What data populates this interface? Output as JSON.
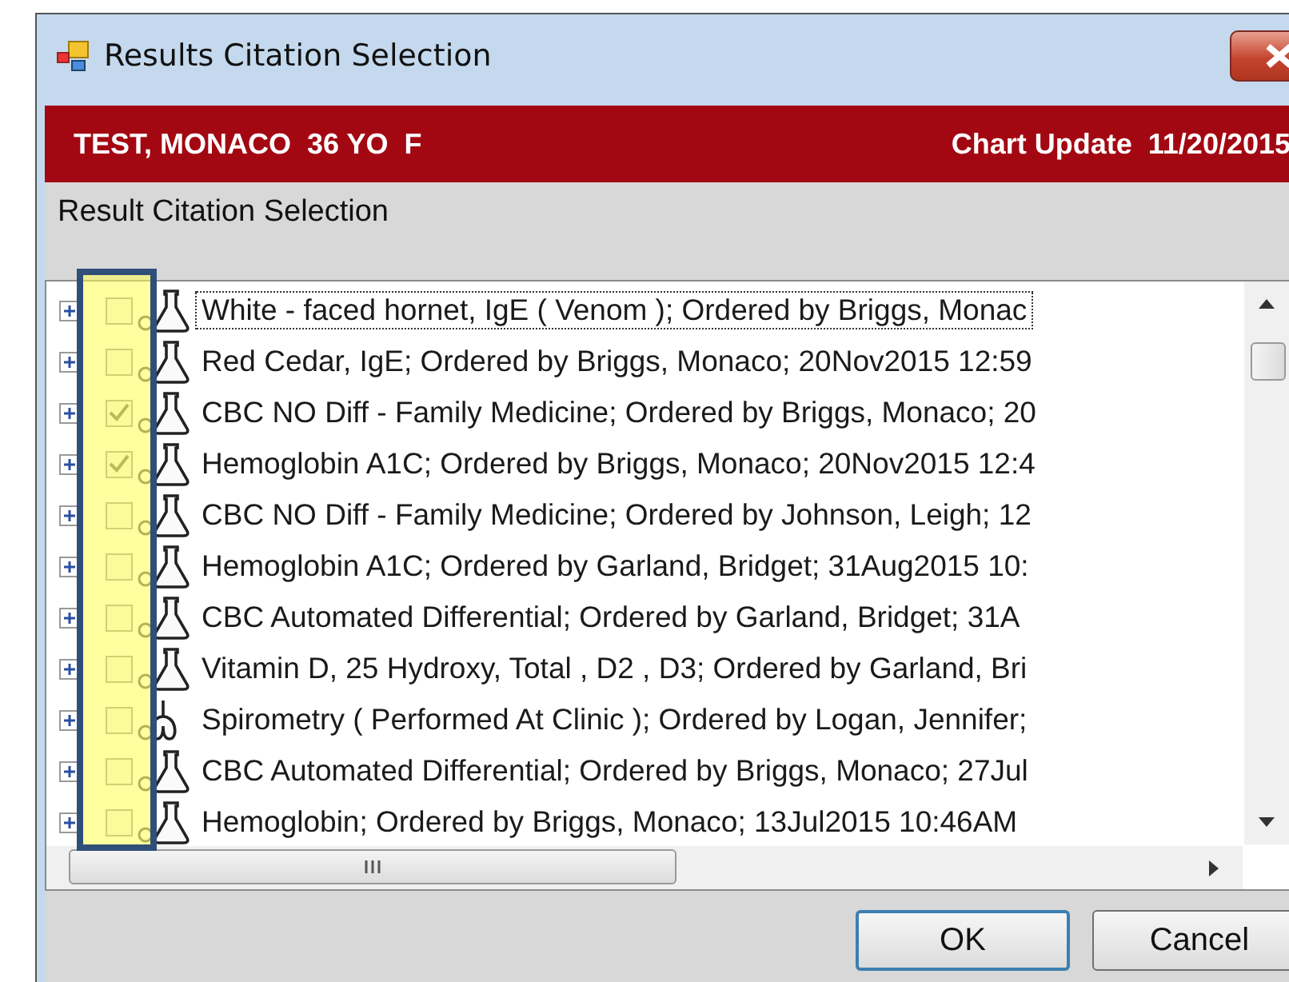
{
  "window": {
    "title": "Results Citation Selection"
  },
  "header": {
    "patient": "TEST, MONACO  36 YO  F",
    "chart_update": "Chart Update  11/20/2015"
  },
  "section_label": "Result Citation Selection",
  "results": [
    {
      "text": "White - faced hornet, IgE ( Venom ); Ordered by Briggs, Monac",
      "checked": false,
      "focused": true,
      "kind": "flask"
    },
    {
      "text": "Red Cedar, IgE; Ordered by Briggs, Monaco; 20Nov2015 12:59",
      "checked": false,
      "focused": false,
      "kind": "flask"
    },
    {
      "text": "CBC NO Diff - Family Medicine; Ordered by Briggs, Monaco; 20",
      "checked": true,
      "focused": false,
      "kind": "flask"
    },
    {
      "text": "Hemoglobin A1C; Ordered by Briggs, Monaco; 20Nov2015 12:4",
      "checked": true,
      "focused": false,
      "kind": "flask"
    },
    {
      "text": "CBC NO Diff - Family Medicine; Ordered by Johnson, Leigh; 12",
      "checked": false,
      "focused": false,
      "kind": "flask"
    },
    {
      "text": "Hemoglobin A1C; Ordered by Garland, Bridget; 31Aug2015 10:",
      "checked": false,
      "focused": false,
      "kind": "flask"
    },
    {
      "text": "CBC Automated Differential; Ordered by Garland, Bridget; 31A",
      "checked": false,
      "focused": false,
      "kind": "flask"
    },
    {
      "text": "Vitamin D, 25 Hydroxy, Total , D2 , D3; Ordered by Garland, Bri",
      "checked": false,
      "focused": false,
      "kind": "flask"
    },
    {
      "text": "Spirometry ( Performed At Clinic ); Ordered by Logan, Jennifer;",
      "checked": false,
      "focused": false,
      "kind": "procedure"
    },
    {
      "text": "CBC Automated Differential; Ordered by Briggs, Monaco; 27Jul",
      "checked": false,
      "focused": false,
      "kind": "flask"
    },
    {
      "text": "Hemoglobin; Ordered by Briggs, Monaco; 13Jul2015 10:46AM",
      "checked": false,
      "focused": false,
      "kind": "flask"
    }
  ],
  "buttons": [
    {
      "label": "OK",
      "default": true
    },
    {
      "label": "Cancel",
      "default": false
    }
  ]
}
